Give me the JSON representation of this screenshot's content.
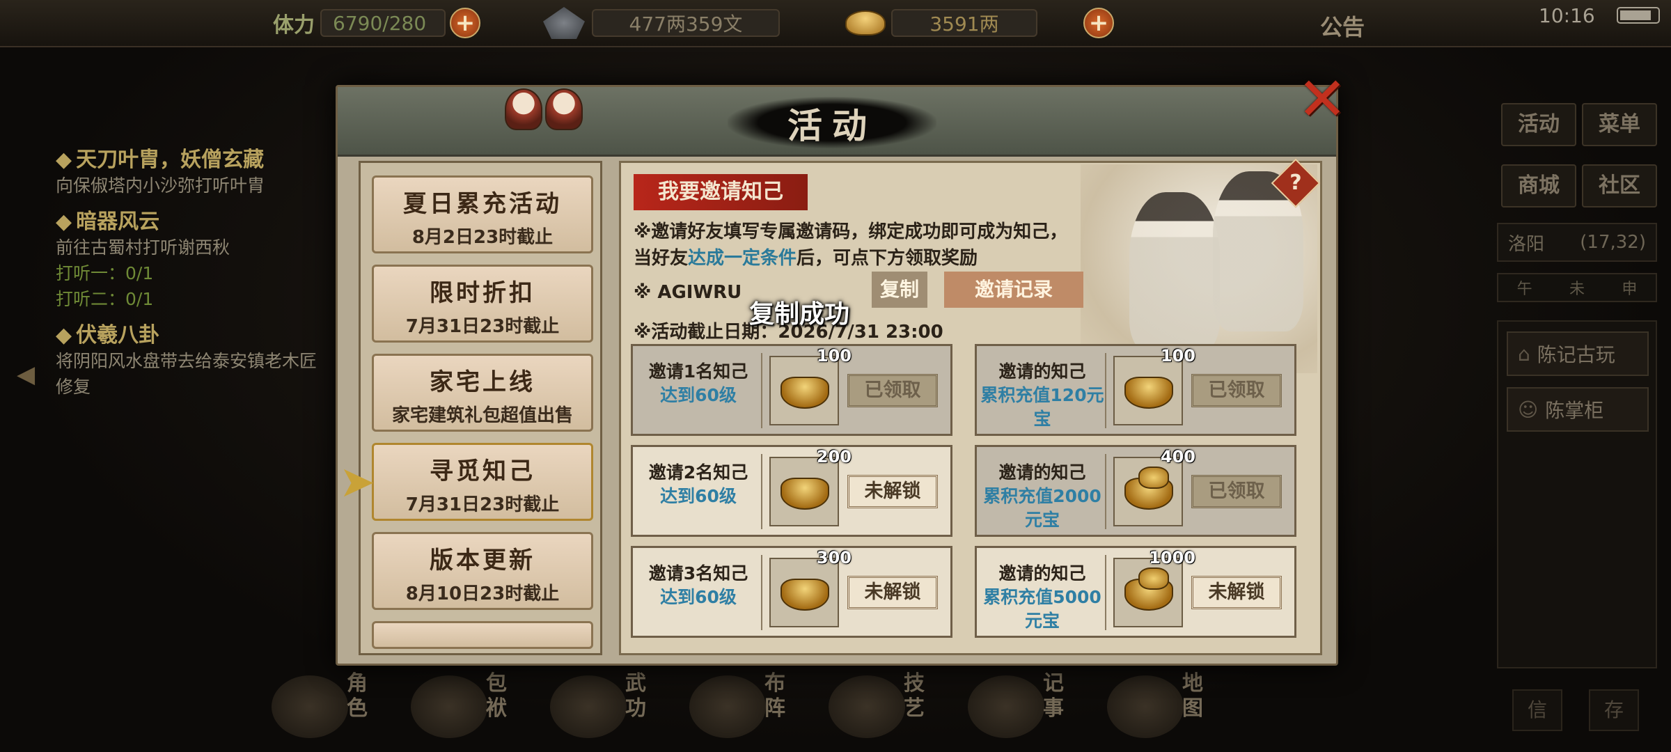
{
  "topbar": {
    "stamina_label": "体力",
    "stamina_value": "6790/280",
    "silver_value": "477两359文",
    "gold_value": "3591两",
    "announce_label": "公告",
    "clock": "10:16"
  },
  "quests": [
    {
      "title": "天刀叶胄，妖僧玄藏",
      "desc": "向保俶塔内小沙弥打听叶胄"
    },
    {
      "title": "暗器风云",
      "desc": "前往古蜀村打听谢西秋",
      "progress": [
        "打听一：0/1",
        "打听二：0/1"
      ]
    },
    {
      "title": "伏羲八卦",
      "desc": "将阴阳风水盘带去给泰安镇老木匠修复"
    }
  ],
  "right_panel": {
    "buttons": [
      "活动",
      "菜单",
      "商城",
      "社区"
    ],
    "location": "洛阳",
    "coords": "(17,32)",
    "times": [
      "午",
      "未",
      "申"
    ],
    "npcs": [
      "陈记古玩",
      "陈掌柜"
    ],
    "corner_buttons": [
      "信",
      "存"
    ]
  },
  "bottom_nav": [
    {
      "label": "角色"
    },
    {
      "label": "包袱"
    },
    {
      "label": "武功"
    },
    {
      "label": "布阵"
    },
    {
      "label": "技艺"
    },
    {
      "label": "记事"
    },
    {
      "label": "地图"
    }
  ],
  "modal": {
    "title": "活动",
    "events": [
      {
        "name": "夏日累充活动",
        "sub": "8月2日23时截止"
      },
      {
        "name": "限时折扣",
        "sub": "7月31日23时截止"
      },
      {
        "name": "家宅上线",
        "sub": "家宅建筑礼包超值出售"
      },
      {
        "name": "寻觅知己",
        "sub": "7月31日23时截止"
      },
      {
        "name": "版本更新",
        "sub": "8月10日23时截止"
      }
    ],
    "invite": {
      "banner": "我要邀请知己",
      "desc_prefix": "※邀请好友填写专属邀请码，绑定成功即可成为知己，当好友",
      "desc_link": "达成一定条件",
      "desc_suffix": "后，可点下方领取奖励",
      "code_label": "※ AGIWRU",
      "copy_button": "复制",
      "record_button": "邀请记录",
      "deadline": "※活动截止日期：2026/7/31 23:00",
      "toast": "复制成功",
      "help": "?"
    },
    "rewards_left": [
      {
        "req": "邀请1名知己",
        "cond": "达到60级",
        "qty": "100",
        "state": "已领取",
        "claimed": true
      },
      {
        "req": "邀请2名知己",
        "cond": "达到60级",
        "qty": "200",
        "state": "未解锁",
        "claimed": false
      },
      {
        "req": "邀请3名知己",
        "cond": "达到60级",
        "qty": "300",
        "state": "未解锁",
        "claimed": false
      }
    ],
    "rewards_right": [
      {
        "req": "邀请的知己",
        "cond": "累积充值120元宝",
        "qty": "100",
        "state": "已领取",
        "claimed": true
      },
      {
        "req": "邀请的知己",
        "cond": "累积充值2000元宝",
        "qty": "400",
        "state": "已领取",
        "claimed": true
      },
      {
        "req": "邀请的知己",
        "cond": "累积充值5000元宝",
        "qty": "1000",
        "state": "未解锁",
        "claimed": false
      }
    ]
  }
}
